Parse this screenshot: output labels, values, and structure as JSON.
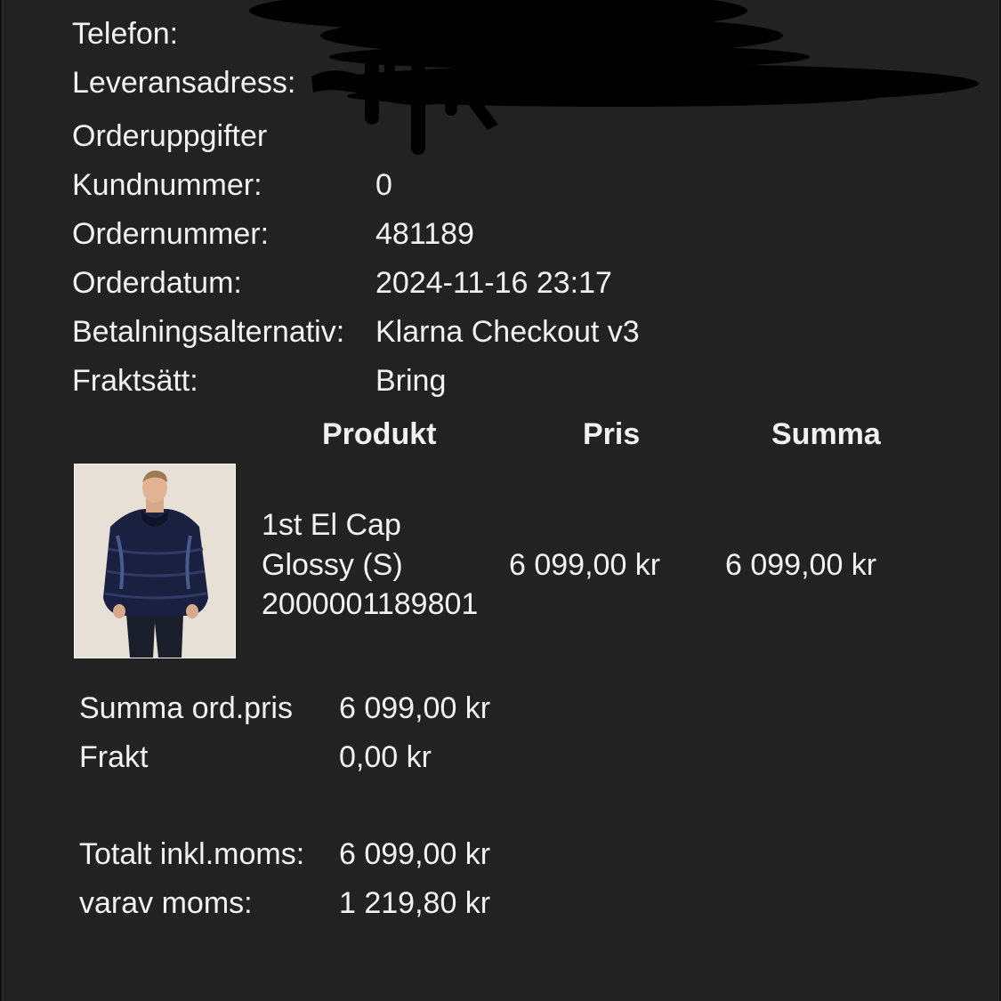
{
  "customer": {
    "phone_label": "Telefon:",
    "address_label": "Leveransadress:"
  },
  "order_details": {
    "heading": "Orderuppgifter",
    "rows": [
      {
        "label": "Kundnummer:",
        "value": "0"
      },
      {
        "label": "Ordernummer:",
        "value": "481189"
      },
      {
        "label": "Orderdatum:",
        "value": "2024-11-16 23:17"
      },
      {
        "label": "Betalningsalternativ:",
        "value": "Klarna Checkout v3"
      },
      {
        "label": "Fraktsätt:",
        "value": "Bring"
      }
    ]
  },
  "product_table": {
    "headers": {
      "product": "Produkt",
      "price": "Pris",
      "sum": "Summa"
    },
    "items": [
      {
        "name_line1": "1st El Cap",
        "name_line2": "Glossy (S)",
        "sku": "2000001189801",
        "price": "6 099,00 kr",
        "sum": "6 099,00 kr"
      }
    ]
  },
  "totals": {
    "rows": [
      {
        "label": "Summa ord.pris",
        "value": "6 099,00 kr"
      },
      {
        "label": "Frakt",
        "value": "0,00 kr"
      },
      {
        "label": "Totalt inkl.moms:",
        "value": "6 099,00 kr"
      },
      {
        "label": "varav moms:",
        "value": "1 219,80 kr"
      }
    ]
  },
  "colors": {
    "background": "#222222",
    "text": "#f2f2f2",
    "redaction": "#000000"
  }
}
